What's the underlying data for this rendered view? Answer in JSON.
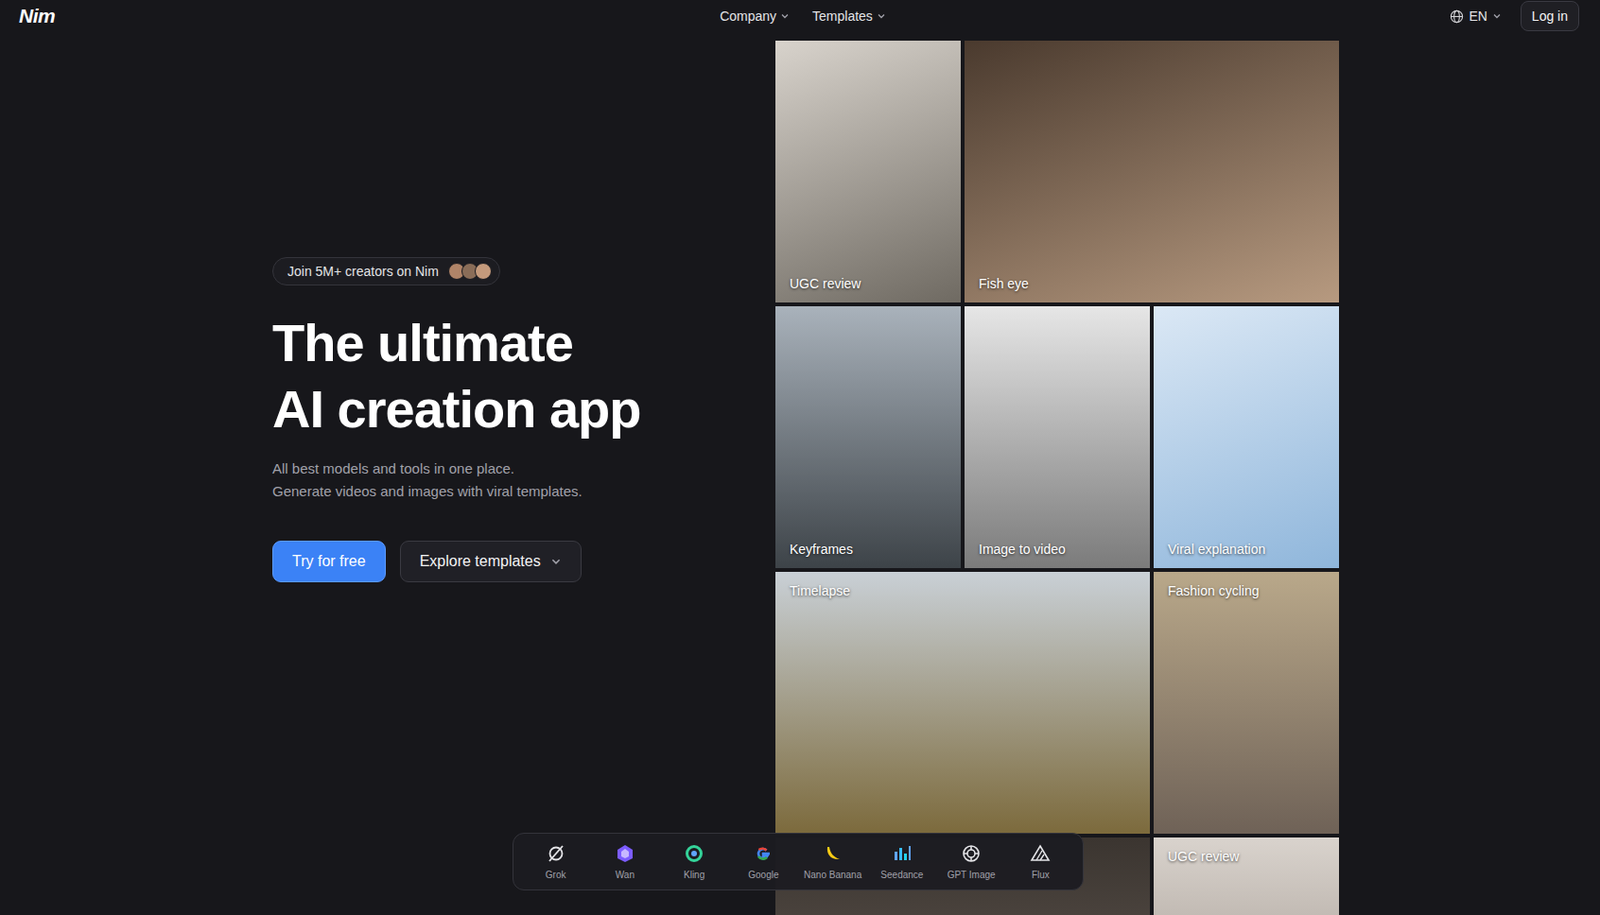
{
  "nav": {
    "logo": "Nim",
    "links": [
      {
        "label": "Company"
      },
      {
        "label": "Templates"
      }
    ],
    "language": "EN",
    "login": "Log in"
  },
  "hero": {
    "badge": "Join 5M+ creators on Nim",
    "title": [
      "The ultimate",
      "AI creation app"
    ],
    "subtitle": [
      "All best models and tools in one place.",
      "Generate videos and images with viral templates."
    ],
    "primary": "Try for free",
    "secondary": "Explore templates"
  },
  "tiles": [
    {
      "label": "UGC review",
      "kind": "square"
    },
    {
      "label": "Fish eye",
      "kind": "wide"
    },
    {
      "label": "Keyframes",
      "kind": "square"
    },
    {
      "label": "Image to video",
      "kind": "square"
    },
    {
      "label": "Viral explanation",
      "kind": "square"
    },
    {
      "label": "Timelapse",
      "kind": "wide"
    },
    {
      "label": "Fashion cycling",
      "kind": "square"
    },
    {
      "kind": "wide"
    },
    {
      "label": "UGC review",
      "kind": "square"
    }
  ],
  "models": [
    {
      "name": "Grok"
    },
    {
      "name": "Wan"
    },
    {
      "name": "Kling"
    },
    {
      "name": "Google"
    },
    {
      "name": "Nano Banana"
    },
    {
      "name": "Seedance"
    },
    {
      "name": "GPT Image"
    },
    {
      "name": "Flux"
    }
  ]
}
